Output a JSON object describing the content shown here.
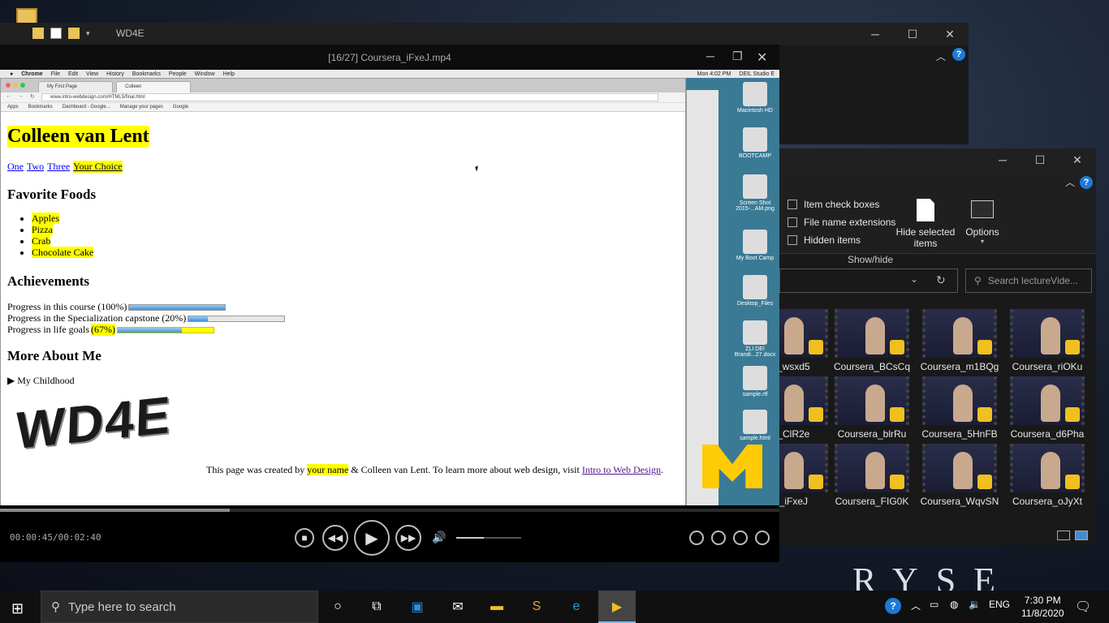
{
  "explorer_back": {
    "title": "WD4E"
  },
  "explorer_front": {
    "ribbon": {
      "item_check_boxes": "Item check boxes",
      "file_name_extensions": "File name extensions",
      "hidden_items": "Hidden items",
      "hide_selected": "Hide selected items",
      "options": "Options",
      "group_label": "Show/hide"
    },
    "search_placeholder": "Search lectureVide...",
    "thumbnails": [
      {
        "caption": "a_wsxd5"
      },
      {
        "caption": "Coursera_BCsCq"
      },
      {
        "caption": "Coursera_m1BQg"
      },
      {
        "caption": "Coursera_riOKu"
      },
      {
        "caption": "a_ClR2e"
      },
      {
        "caption": "Coursera_blrRu"
      },
      {
        "caption": "Coursera_5HnFB"
      },
      {
        "caption": "Coursera_d6Pha"
      },
      {
        "caption": "a_iFxeJ"
      },
      {
        "caption": "Coursera_FIG0K"
      },
      {
        "caption": "Coursera_WqvSN"
      },
      {
        "caption": "Coursera_oJyXt"
      }
    ]
  },
  "player": {
    "title": "[16/27] Coursera_iFxeJ.mp4",
    "time": "00:00:45/00:02:40",
    "progress_fraction": 0.295,
    "volume_fraction": 0.42
  },
  "mac": {
    "menu": [
      "Chrome",
      "File",
      "Edit",
      "View",
      "History",
      "Bookmarks",
      "People",
      "Window",
      "Help"
    ],
    "clock": "Mon 4:02 PM",
    "studio": "DEIL Studio E",
    "desktop_icons": [
      "Macintosh HD",
      "BOOTCAMP",
      "Screen Shot 2015-...AM.png",
      "My Boot Camp",
      "Desktop_Files",
      "ZLI DEI Brandi...27.docx",
      "sample.rtf",
      "sample.html"
    ]
  },
  "chrome": {
    "tabs": [
      "My First Page",
      "Colleen"
    ],
    "url": "www.intro-webdesign.com/HTML5/final.html",
    "bookmarks": [
      "Apps",
      "Bookmarks",
      "Dashboard - Google...",
      "Manage your pages",
      "Google"
    ]
  },
  "webpage": {
    "name": "Colleen van Lent",
    "nav": [
      "One",
      "Two",
      "Three",
      "Your Choice"
    ],
    "foods_heading": "Favorite Foods",
    "foods": [
      "Apples",
      "Pizza",
      "Crab",
      "Chocolate Cake"
    ],
    "achievements_heading": "Achievements",
    "progress": [
      {
        "label": "Progress in this course (100%)",
        "value": 1.0
      },
      {
        "label": "Progress in the Specialization capstone (20%)",
        "value": 0.2
      },
      {
        "label": "Progress in life goals",
        "highlight": "(67%)",
        "value": 0.67
      }
    ],
    "more_heading": "More About Me",
    "details_summary": "My Childhood",
    "logo_text": "WD4E",
    "footer_pre": "This page was created by ",
    "footer_name": "your name",
    "footer_mid": " & Colleen van Lent. To learn more about web design, visit ",
    "footer_link": "Intro to Web Design",
    "footer_end": "."
  },
  "taskbar": {
    "search_placeholder": "Type here to search",
    "lang": "ENG",
    "time": "7:30 PM",
    "date": "11/8/2020"
  },
  "wallpaper_text": "RYSE"
}
